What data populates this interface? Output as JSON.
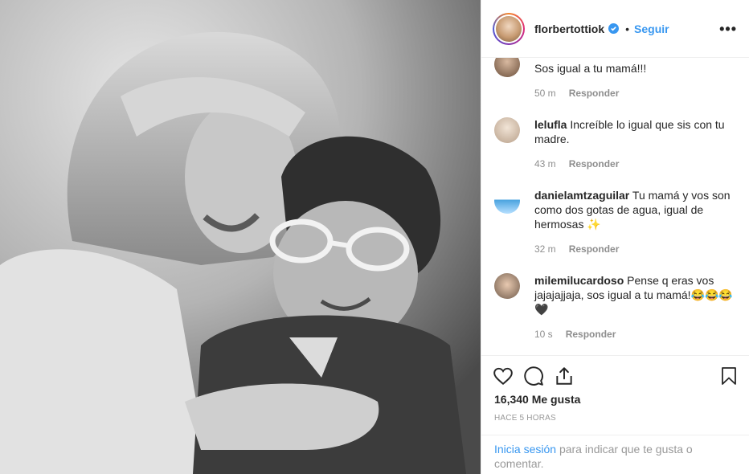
{
  "header": {
    "username": "florbertottiok",
    "follow_label": "Seguir",
    "separator": "•",
    "more_label": "•••"
  },
  "comments": [
    {
      "username": "",
      "text": "Sos igual a tu mamá!!!",
      "time": "50 m",
      "reply_label": "Responder"
    },
    {
      "username": "lelufla",
      "text": "Increíble lo igual que sis con tu madre.",
      "time": "43 m",
      "reply_label": "Responder"
    },
    {
      "username": "danielamtzaguilar",
      "text": "Tu mamá y vos son como dos gotas de agua, igual de hermosas ✨",
      "time": "32 m",
      "reply_label": "Responder"
    },
    {
      "username": "milemilucardoso",
      "text": "Pense q eras vos jajajajjaja, sos igual a tu mamá!😂😂😂 🖤",
      "time": "10 s",
      "reply_label": "Responder"
    }
  ],
  "actions": {
    "likes": "16,340 Me gusta",
    "timestamp": "HACE 5 HORAS",
    "login_link": "Inicia sesión",
    "login_text": "para indicar que te gusta o comentar."
  },
  "icons": [
    "verified-badge-icon",
    "heart-icon",
    "comment-icon",
    "share-icon",
    "bookmark-icon",
    "more-options-icon"
  ],
  "colors": {
    "link_blue": "#3897f0",
    "meta_gray": "#8e8e8e",
    "border": "#efefef"
  }
}
